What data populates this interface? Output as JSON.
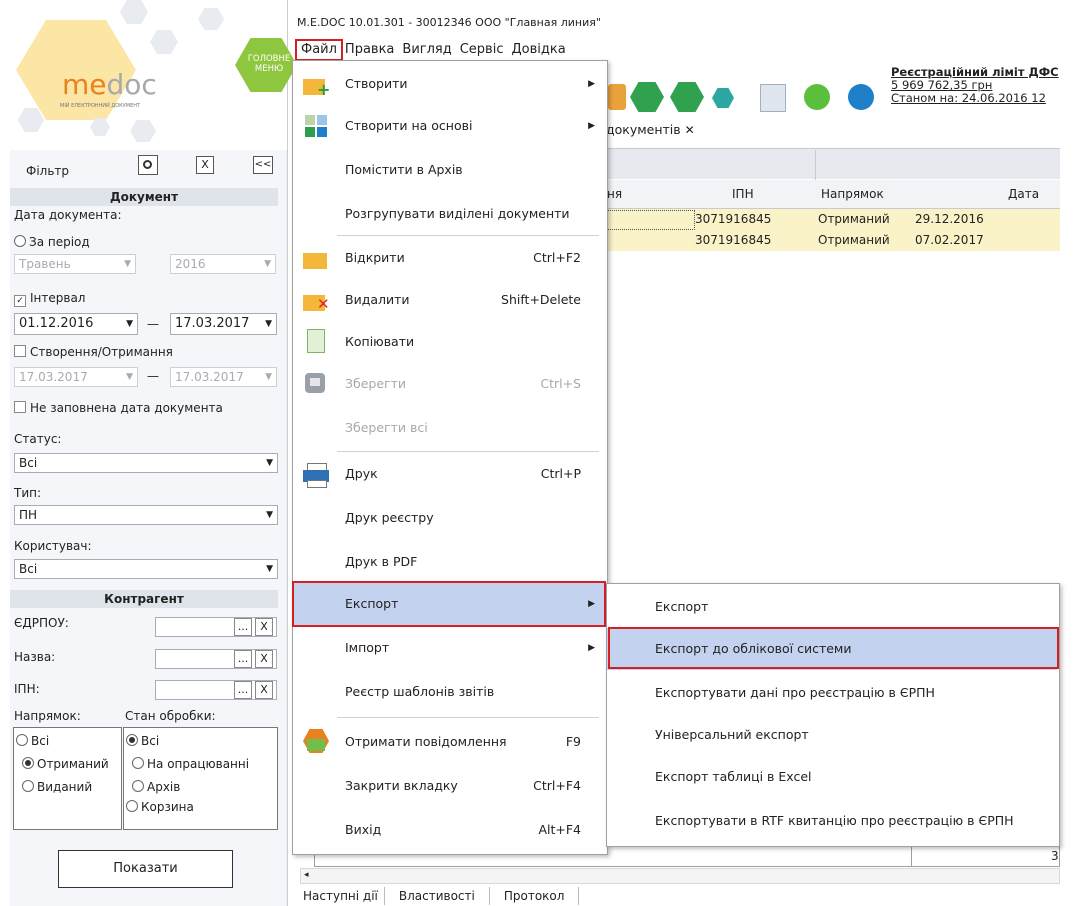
{
  "window": {
    "title": "M.E.DOC 10.01.301  - 30012346 ООО \"Главная линия\""
  },
  "menubar": [
    "Файл",
    "Правка",
    "Вигляд",
    "Сервіс",
    "Довідка"
  ],
  "logo": {
    "brand_me": "me",
    "brand_doc": "doc",
    "tagline": "МІЙ ЕЛЕКТРОННИЙ ДОКУМЕНТ",
    "main_menu": "ГОЛОВНЕ\nМЕНЮ"
  },
  "filter": {
    "title": "Фільтр",
    "collapse_label": "<<",
    "close_label": "X",
    "doc_section": "Документ",
    "doc_date_label": "Дата документа:",
    "period_label": "За період",
    "period_month": "Травень",
    "period_year": "2016",
    "interval_label": "Інтервал",
    "interval_checked": true,
    "interval_from": "01.12.2016",
    "interval_to": "17.03.2017",
    "dash": "—",
    "created_label": "Створення/Отримання",
    "created_from": "17.03.2017",
    "created_to": "17.03.2017",
    "nodate_label": "Не заповнена дата документа",
    "status_label": "Статус:",
    "status_value": "Всі",
    "type_label": "Тип:",
    "type_value": "ПН",
    "user_label": "Користувач:",
    "user_value": "Всі",
    "counterparty_section": "Контрагент",
    "edrpou_label": "ЄДРПОУ:",
    "name_label": "Назва:",
    "ipn_label": "ІПН:",
    "browse_label": "...",
    "clear_label": "X",
    "direction_label": "Напрямок:",
    "state_label": "Стан обробки:",
    "direction_options": [
      "Всі",
      "Отриманий",
      "Виданий"
    ],
    "direction_selected": 1,
    "state_options": [
      "Всі",
      "На опрацюванні",
      "Архів",
      "Корзина"
    ],
    "state_selected": 0,
    "show_button": "Показати"
  },
  "registration": {
    "line1": "Реєстраційний ліміт ДФС",
    "line2": "5 969 762,35 грн",
    "line3": "Станом на: 24.06.2016 12"
  },
  "tab": {
    "label": "документів",
    "close": "✕"
  },
  "grid": {
    "columns": [
      "ня",
      "ІПН",
      "Напрямок",
      "Дата"
    ],
    "rows": [
      {
        "ipn": "3071916845",
        "direction": "Отриманий",
        "date": "29.12.2016"
      },
      {
        "ipn": "3071916845",
        "direction": "Отриманий",
        "date": "07.02.2017"
      }
    ],
    "footer_digit": "3"
  },
  "file_menu": [
    {
      "label": "Створити",
      "shortcut": "",
      "submenu": true,
      "disabled": false,
      "icon": "create-icon"
    },
    {
      "label": "Створити на основі",
      "shortcut": "",
      "submenu": true,
      "disabled": false,
      "icon": "create-based-icon"
    },
    {
      "label": "Помістити в Архів",
      "shortcut": "",
      "submenu": false,
      "disabled": false,
      "icon": ""
    },
    {
      "label": "Розгрупувати виділені документи",
      "shortcut": "",
      "submenu": false,
      "disabled": false,
      "icon": ""
    },
    {
      "label": "Відкрити",
      "shortcut": "Ctrl+F2",
      "submenu": false,
      "disabled": false,
      "icon": "open-folder-icon"
    },
    {
      "label": "Видалити",
      "shortcut": "Shift+Delete",
      "submenu": false,
      "disabled": false,
      "icon": "delete-folder-icon"
    },
    {
      "label": "Копіювати",
      "shortcut": "",
      "submenu": false,
      "disabled": false,
      "icon": "copy-icon"
    },
    {
      "label": "Зберегти",
      "shortcut": "Ctrl+S",
      "submenu": false,
      "disabled": true,
      "icon": "save-icon"
    },
    {
      "label": "Зберегти всі",
      "shortcut": "",
      "submenu": false,
      "disabled": true,
      "icon": ""
    },
    {
      "label": "Друк",
      "shortcut": "Ctrl+P",
      "submenu": false,
      "disabled": false,
      "icon": "printer-icon"
    },
    {
      "label": "Друк реєстру",
      "shortcut": "",
      "submenu": false,
      "disabled": false,
      "icon": ""
    },
    {
      "label": "Друк в PDF",
      "shortcut": "",
      "submenu": false,
      "disabled": false,
      "icon": ""
    },
    {
      "label": "Експорт",
      "shortcut": "",
      "submenu": true,
      "disabled": false,
      "icon": "",
      "highlight": true
    },
    {
      "label": "Імпорт",
      "shortcut": "",
      "submenu": true,
      "disabled": false,
      "icon": ""
    },
    {
      "label": "Реєстр шаблонів звітів",
      "shortcut": "",
      "submenu": false,
      "disabled": false,
      "icon": ""
    },
    {
      "label": "Отримати повідомлення",
      "shortcut": "F9",
      "submenu": false,
      "disabled": false,
      "icon": "receive-messages-icon"
    },
    {
      "label": "Закрити вкладку",
      "shortcut": "Ctrl+F4",
      "submenu": false,
      "disabled": false,
      "icon": ""
    },
    {
      "label": "Вихід",
      "shortcut": "Alt+F4",
      "submenu": false,
      "disabled": false,
      "icon": ""
    }
  ],
  "export_submenu": [
    {
      "label": "Експорт"
    },
    {
      "label": "Експорт до облікової системи",
      "highlight": true
    },
    {
      "label": "Експортувати дані про реєстрацію в ЄРПН"
    },
    {
      "label": "Універсальний експорт"
    },
    {
      "label": "Експорт таблиці в Excel"
    },
    {
      "label": "Експортувати в RTF квитанцію про реєстрацію в ЄРПН"
    }
  ],
  "bottom_tabs": [
    "Наступні дії",
    "Властивості",
    "Протокол"
  ],
  "colors": {
    "highlight": "#c3d3ef",
    "accent_red": "#d51f25",
    "row_yellow": "#faf3c8",
    "logo_orange": "#e8821e",
    "logo_green": "#8fc63f"
  }
}
